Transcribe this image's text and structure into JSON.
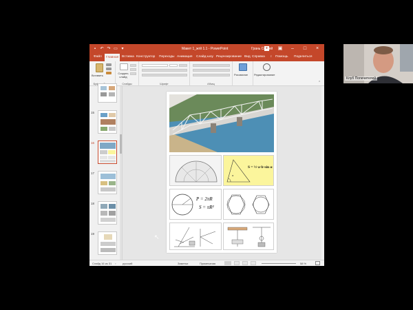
{
  "window": {
    "title": "Макет 1_жгй 1.1  -  PowerPoint",
    "user": "Грань Сергей",
    "share": "Поделиться",
    "help": "Помощь"
  },
  "tabs": [
    "Файл",
    "Главная",
    "Вставка",
    "Конструктор",
    "Переходы",
    "Анимация",
    "Слайд-шоу",
    "Рецензирование",
    "Вид",
    "Справка"
  ],
  "ribbon": {
    "paste": "Вставить",
    "clipboard": "Буфер обмена",
    "new_slide": "Создать слайд",
    "slides": "Слайды",
    "font": "Шрифт",
    "paragraph": "Абзац",
    "drawing": "Рисование",
    "editing": "Редактирование"
  },
  "thumbnails": {
    "numbers": [
      "15",
      "16",
      "17",
      "18",
      "19"
    ]
  },
  "slide": {
    "formula_area": "S = ½·a·b·sin α",
    "formula_circle_1": "P = 2πR",
    "formula_circle_2": "S = πR²",
    "angle_label": "α"
  },
  "status": {
    "slide_of": "Слайд 16 из 31",
    "language": "русский",
    "notes": "Заметки",
    "comments": "Примечания",
    "zoom": "58 %"
  },
  "webcam": {
    "label": "Клуб Попечителей"
  },
  "colors": {
    "accent": "#c4472a",
    "formula_bg": "#fbf59c"
  }
}
